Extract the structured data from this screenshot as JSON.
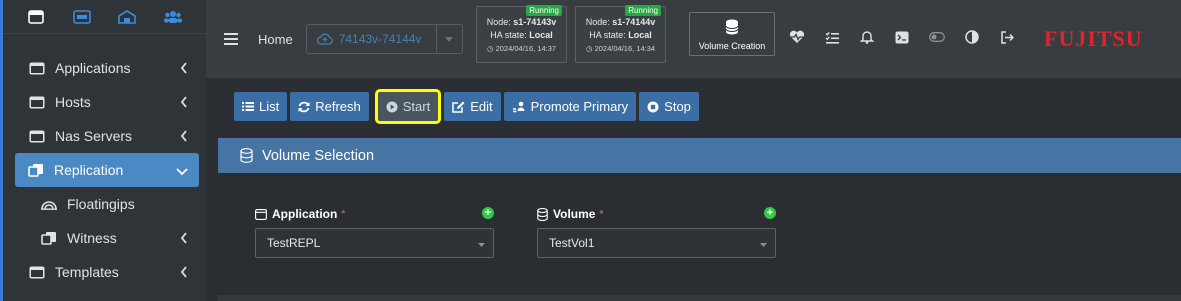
{
  "sidebar": {
    "items": [
      {
        "label": "Applications",
        "icon": "window-icon"
      },
      {
        "label": "Hosts",
        "icon": "window-icon"
      },
      {
        "label": "Nas Servers",
        "icon": "window-icon"
      },
      {
        "label": "Replication",
        "icon": "copy-icon"
      },
      {
        "label": "Floatingips",
        "icon": "rainbow-icon"
      },
      {
        "label": "Witness",
        "icon": "copy-icon"
      },
      {
        "label": "Templates",
        "icon": "window-icon"
      }
    ]
  },
  "header": {
    "home": "Home",
    "cluster": "74143v-74144v",
    "nodes": [
      {
        "badge": "Running",
        "node_prefix": "Node: ",
        "node": "s1-74143v",
        "ha_prefix": "HA state: ",
        "ha": "Local",
        "time": "2024/04/16, 14:37"
      },
      {
        "badge": "Running",
        "node_prefix": "Node: ",
        "node": "s1-74144v",
        "ha_prefix": "HA state: ",
        "ha": "Local",
        "time": "2024/04/16, 14:34"
      }
    ],
    "volume_creation": "Volume Creation",
    "brand": "FUJITSU"
  },
  "toolbar": {
    "list": "List",
    "refresh": "Refresh",
    "start": "Start",
    "edit": "Edit",
    "promote": "Promote Primary",
    "stop": "Stop"
  },
  "panel": {
    "title": "Volume Selection",
    "application": {
      "label": "Application",
      "required": "*",
      "value": "TestREPL"
    },
    "volume": {
      "label": "Volume",
      "required": "*",
      "value": "TestVol1"
    }
  },
  "colors": {
    "accent": "#3a6ea5",
    "panel_header": "#4674a3",
    "brand": "#e0242b",
    "highlight": "#ffff00",
    "running": "#28a745"
  }
}
